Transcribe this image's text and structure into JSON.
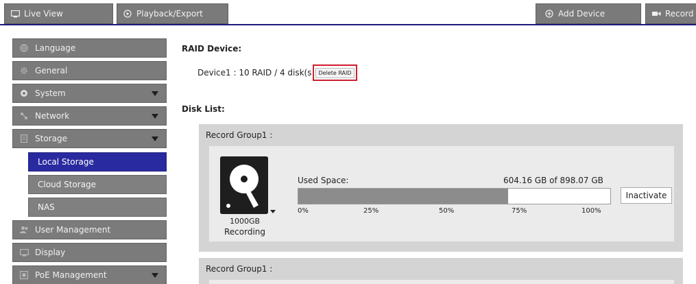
{
  "topbar": {
    "live_view": "Live View",
    "playback_export": "Playback/Export",
    "add_device": "Add Device",
    "record": "Record"
  },
  "sidebar": {
    "items": [
      {
        "label": "Language"
      },
      {
        "label": "General"
      },
      {
        "label": "System"
      },
      {
        "label": "Network"
      },
      {
        "label": "Storage"
      }
    ],
    "storage_sub": [
      {
        "label": "Local Storage"
      },
      {
        "label": "Cloud Storage"
      },
      {
        "label": "NAS"
      }
    ],
    "items_after": [
      {
        "label": "User Management"
      },
      {
        "label": "Display"
      },
      {
        "label": "PoE Management"
      }
    ]
  },
  "main": {
    "raid_heading": "RAID Device:",
    "device_text": "Device1 :  10 RAID / 4 disk(s",
    "delete_raid": "Delete RAID",
    "disk_list_heading": "Disk List:",
    "groups": [
      {
        "title": "Record Group1 :",
        "disk": {
          "size": "1000GB",
          "status": "Recording"
        },
        "used_label": "Used Space:",
        "used_value": "604.16 GB of 898.07 GB",
        "used_fraction": 0.6727,
        "ticks": [
          "0%",
          "25%",
          "50%",
          "75%",
          "100%"
        ],
        "inactivate": "Inactivate"
      },
      {
        "title": "Record Group1 :"
      }
    ]
  },
  "colors": {
    "active_nav": "#2a2aa0",
    "accent_line": "#1c1a80",
    "highlight_border": "#d11d2d"
  }
}
